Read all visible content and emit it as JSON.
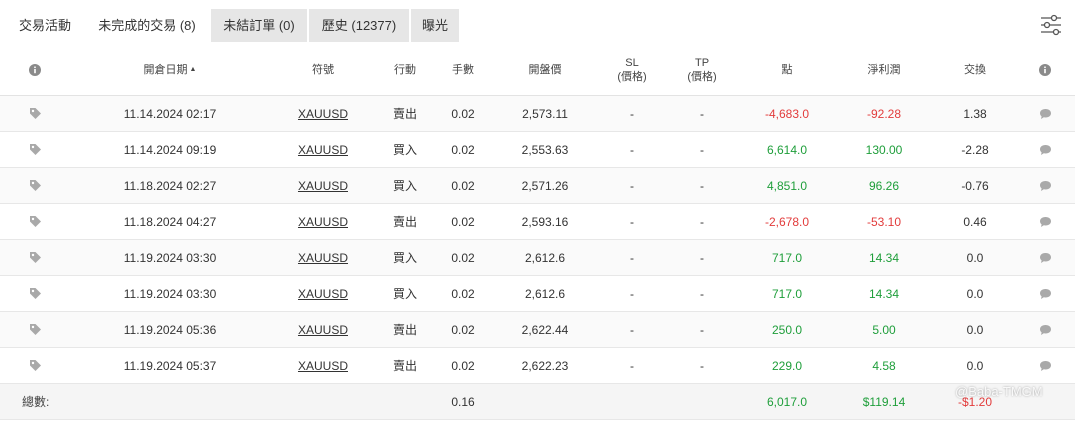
{
  "tabs": [
    {
      "label": "交易活動"
    },
    {
      "label": "未完成的交易 (8)"
    },
    {
      "label": "未結訂單 (0)"
    },
    {
      "label": "歷史 (12377)"
    },
    {
      "label": "曝光"
    }
  ],
  "table": {
    "headers": {
      "open_date": "開倉日期",
      "sort_indicator": "▲",
      "symbol": "符號",
      "action": "行動",
      "lots": "手數",
      "open_price": "開盤價",
      "sl_line1": "SL",
      "sl_line2": "(價格)",
      "tp_line1": "TP",
      "tp_line2": "(價格)",
      "points": "點",
      "net_profit": "淨利潤",
      "swap": "交換"
    },
    "rows": [
      {
        "date": "11.14.2024 02:17",
        "symbol": "XAUUSD",
        "action": "賣出",
        "lots": "0.02",
        "price": "2,573.11",
        "sl": "-",
        "tp": "-",
        "points": "-4,683.0",
        "profit": "-92.28",
        "swap": "1.38",
        "sign": "neg"
      },
      {
        "date": "11.14.2024 09:19",
        "symbol": "XAUUSD",
        "action": "買入",
        "lots": "0.02",
        "price": "2,553.63",
        "sl": "-",
        "tp": "-",
        "points": "6,614.0",
        "profit": "130.00",
        "swap": "-2.28",
        "sign": "pos"
      },
      {
        "date": "11.18.2024 02:27",
        "symbol": "XAUUSD",
        "action": "買入",
        "lots": "0.02",
        "price": "2,571.26",
        "sl": "-",
        "tp": "-",
        "points": "4,851.0",
        "profit": "96.26",
        "swap": "-0.76",
        "sign": "pos"
      },
      {
        "date": "11.18.2024 04:27",
        "symbol": "XAUUSD",
        "action": "賣出",
        "lots": "0.02",
        "price": "2,593.16",
        "sl": "-",
        "tp": "-",
        "points": "-2,678.0",
        "profit": "-53.10",
        "swap": "0.46",
        "sign": "neg"
      },
      {
        "date": "11.19.2024 03:30",
        "symbol": "XAUUSD",
        "action": "買入",
        "lots": "0.02",
        "price": "2,612.6",
        "sl": "-",
        "tp": "-",
        "points": "717.0",
        "profit": "14.34",
        "swap": "0.0",
        "sign": "pos"
      },
      {
        "date": "11.19.2024 03:30",
        "symbol": "XAUUSD",
        "action": "買入",
        "lots": "0.02",
        "price": "2,612.6",
        "sl": "-",
        "tp": "-",
        "points": "717.0",
        "profit": "14.34",
        "swap": "0.0",
        "sign": "pos"
      },
      {
        "date": "11.19.2024 05:36",
        "symbol": "XAUUSD",
        "action": "賣出",
        "lots": "0.02",
        "price": "2,622.44",
        "sl": "-",
        "tp": "-",
        "points": "250.0",
        "profit": "5.00",
        "swap": "0.0",
        "sign": "pos"
      },
      {
        "date": "11.19.2024 05:37",
        "symbol": "XAUUSD",
        "action": "賣出",
        "lots": "0.02",
        "price": "2,622.23",
        "sl": "-",
        "tp": "-",
        "points": "229.0",
        "profit": "4.58",
        "swap": "0.0",
        "sign": "pos"
      }
    ],
    "total": {
      "label": "總數:",
      "lots": "0.16",
      "points": "6,017.0",
      "profit": "$119.14",
      "swap": "-$1.20"
    }
  },
  "watermark": "@Baba-TMGM",
  "icons": {
    "info": "info-icon",
    "tag": "tag-icon",
    "comment": "comment-icon",
    "filter": "sliders-icon"
  },
  "colors": {
    "positive": "#1e9e3a",
    "negative": "#e23b3b",
    "icon_gray": "#a9a9a9",
    "inactive_tab": "#e6e6e6"
  }
}
